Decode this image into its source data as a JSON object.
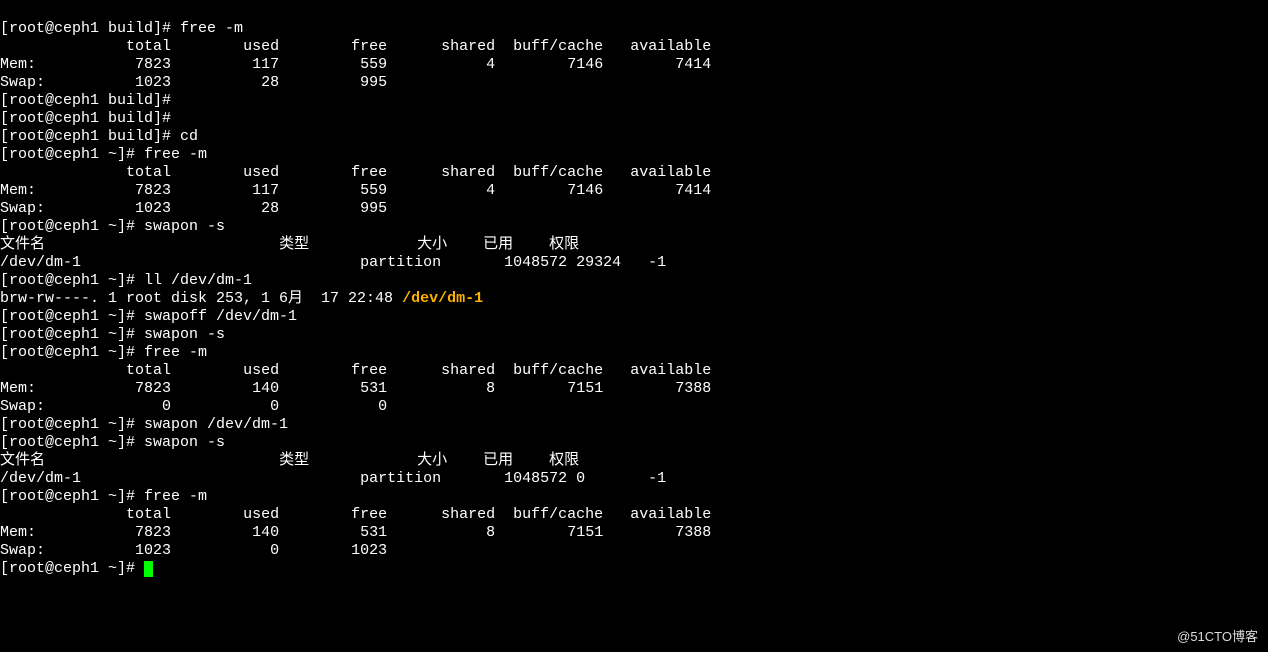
{
  "watermark": "@51CTO博客",
  "prompts": {
    "build": "[root@ceph1 build]# ",
    "home": "[root@ceph1 ~]# "
  },
  "cmds": {
    "free": "free -m",
    "cd": "cd",
    "swapon_s": "swapon -s",
    "ll_dm1": "ll /dev/dm-1",
    "swapoff_dm1": "swapoff /dev/dm-1",
    "swapon_dm1": "swapon /dev/dm-1"
  },
  "free_hdr": {
    "total": "total",
    "used": "used",
    "free": "free",
    "shared": "shared",
    "buffc": "buff/cache",
    "avail": "available"
  },
  "free1": {
    "mem": {
      "label": "Mem:",
      "total": "7823",
      "used": "117",
      "free": "559",
      "shared": "4",
      "buffc": "7146",
      "avail": "7414"
    },
    "swap": {
      "label": "Swap:",
      "total": "1023",
      "used": "28",
      "free": "995"
    }
  },
  "free2": {
    "mem": {
      "label": "Mem:",
      "total": "7823",
      "used": "117",
      "free": "559",
      "shared": "4",
      "buffc": "7146",
      "avail": "7414"
    },
    "swap": {
      "label": "Swap:",
      "total": "1023",
      "used": "28",
      "free": "995"
    }
  },
  "swapon_hdr": {
    "name": "文件名",
    "type": "类型",
    "size": "大小",
    "used": "已用",
    "prio": "权限"
  },
  "swapon1": {
    "name": "/dev/dm-1",
    "type": "partition",
    "size": "1048572",
    "used": "29324",
    "prio": "-1"
  },
  "ll": {
    "perm": "brw-rw----. 1 root disk 253, 1 6月  17 22:48 ",
    "path": "/dev/dm-1"
  },
  "free3": {
    "mem": {
      "label": "Mem:",
      "total": "7823",
      "used": "140",
      "free": "531",
      "shared": "8",
      "buffc": "7151",
      "avail": "7388"
    },
    "swap": {
      "label": "Swap:",
      "total": "0",
      "used": "0",
      "free": "0"
    }
  },
  "swapon2": {
    "name": "/dev/dm-1",
    "type": "partition",
    "size": "1048572",
    "used": "0",
    "prio": "-1"
  },
  "free4": {
    "mem": {
      "label": "Mem:",
      "total": "7823",
      "used": "140",
      "free": "531",
      "shared": "8",
      "buffc": "7151",
      "avail": "7388"
    },
    "swap": {
      "label": "Swap:",
      "total": "1023",
      "used": "0",
      "free": "1023"
    }
  }
}
